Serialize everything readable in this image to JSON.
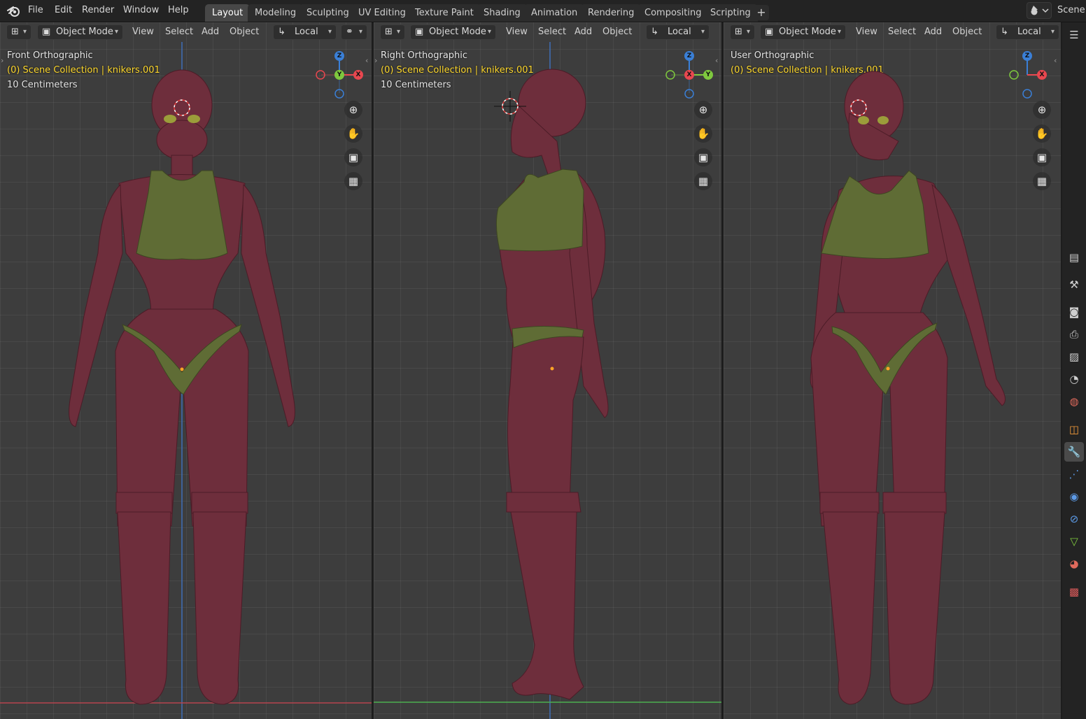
{
  "menu": [
    "File",
    "Edit",
    "Render",
    "Window",
    "Help"
  ],
  "workspaces": [
    "Layout",
    "Modeling",
    "Sculpting",
    "UV Editing",
    "Texture Paint",
    "Shading",
    "Animation",
    "Rendering",
    "Compositing",
    "Scripting"
  ],
  "active_workspace": "Layout",
  "add_workspace": "+",
  "scene_label": "Scene",
  "viewports": [
    {
      "mode": "Object Mode",
      "menus": [
        "View",
        "Select",
        "Add",
        "Object"
      ],
      "transform": "Local",
      "view_name": "Front Orthographic",
      "collection": "(0) Scene Collection | knikers.001",
      "scale": "10 Centimeters",
      "gizmo": {
        "top": "Z",
        "center": "Y",
        "right": "X"
      }
    },
    {
      "mode": "Object Mode",
      "menus": [
        "View",
        "Select",
        "Add",
        "Object"
      ],
      "transform": "Local",
      "view_name": "Right Orthographic",
      "collection": "(0) Scene Collection | knikers.001",
      "scale": "10 Centimeters",
      "gizmo": {
        "top": "Z",
        "center": "X",
        "right": "Y"
      }
    },
    {
      "mode": "Object Mode",
      "menus": [
        "View",
        "Select",
        "Add",
        "Object"
      ],
      "transform": "Local",
      "view_name": "User Orthographic",
      "collection": "(0) Scene Collection | knikers.001",
      "gizmo": {
        "top": "Z",
        "right": "X"
      }
    }
  ],
  "nav_icons": [
    "zoom-icon",
    "pan-hand-icon",
    "camera-icon",
    "grid-icon"
  ],
  "properties_tabs": [
    "tool",
    "render",
    "output",
    "view-layer",
    "scene",
    "world",
    "object",
    "modifiers",
    "particles",
    "physics",
    "constraints",
    "data",
    "material",
    "texture"
  ],
  "active_properties_tab": "modifiers",
  "colors": {
    "skin": "#6e2e3c",
    "cloth": "#5f6c35",
    "axis_x": "#e8474f",
    "axis_y": "#7ec83e",
    "axis_z": "#3a7fd6",
    "info_yellow": "#ffd92e"
  }
}
